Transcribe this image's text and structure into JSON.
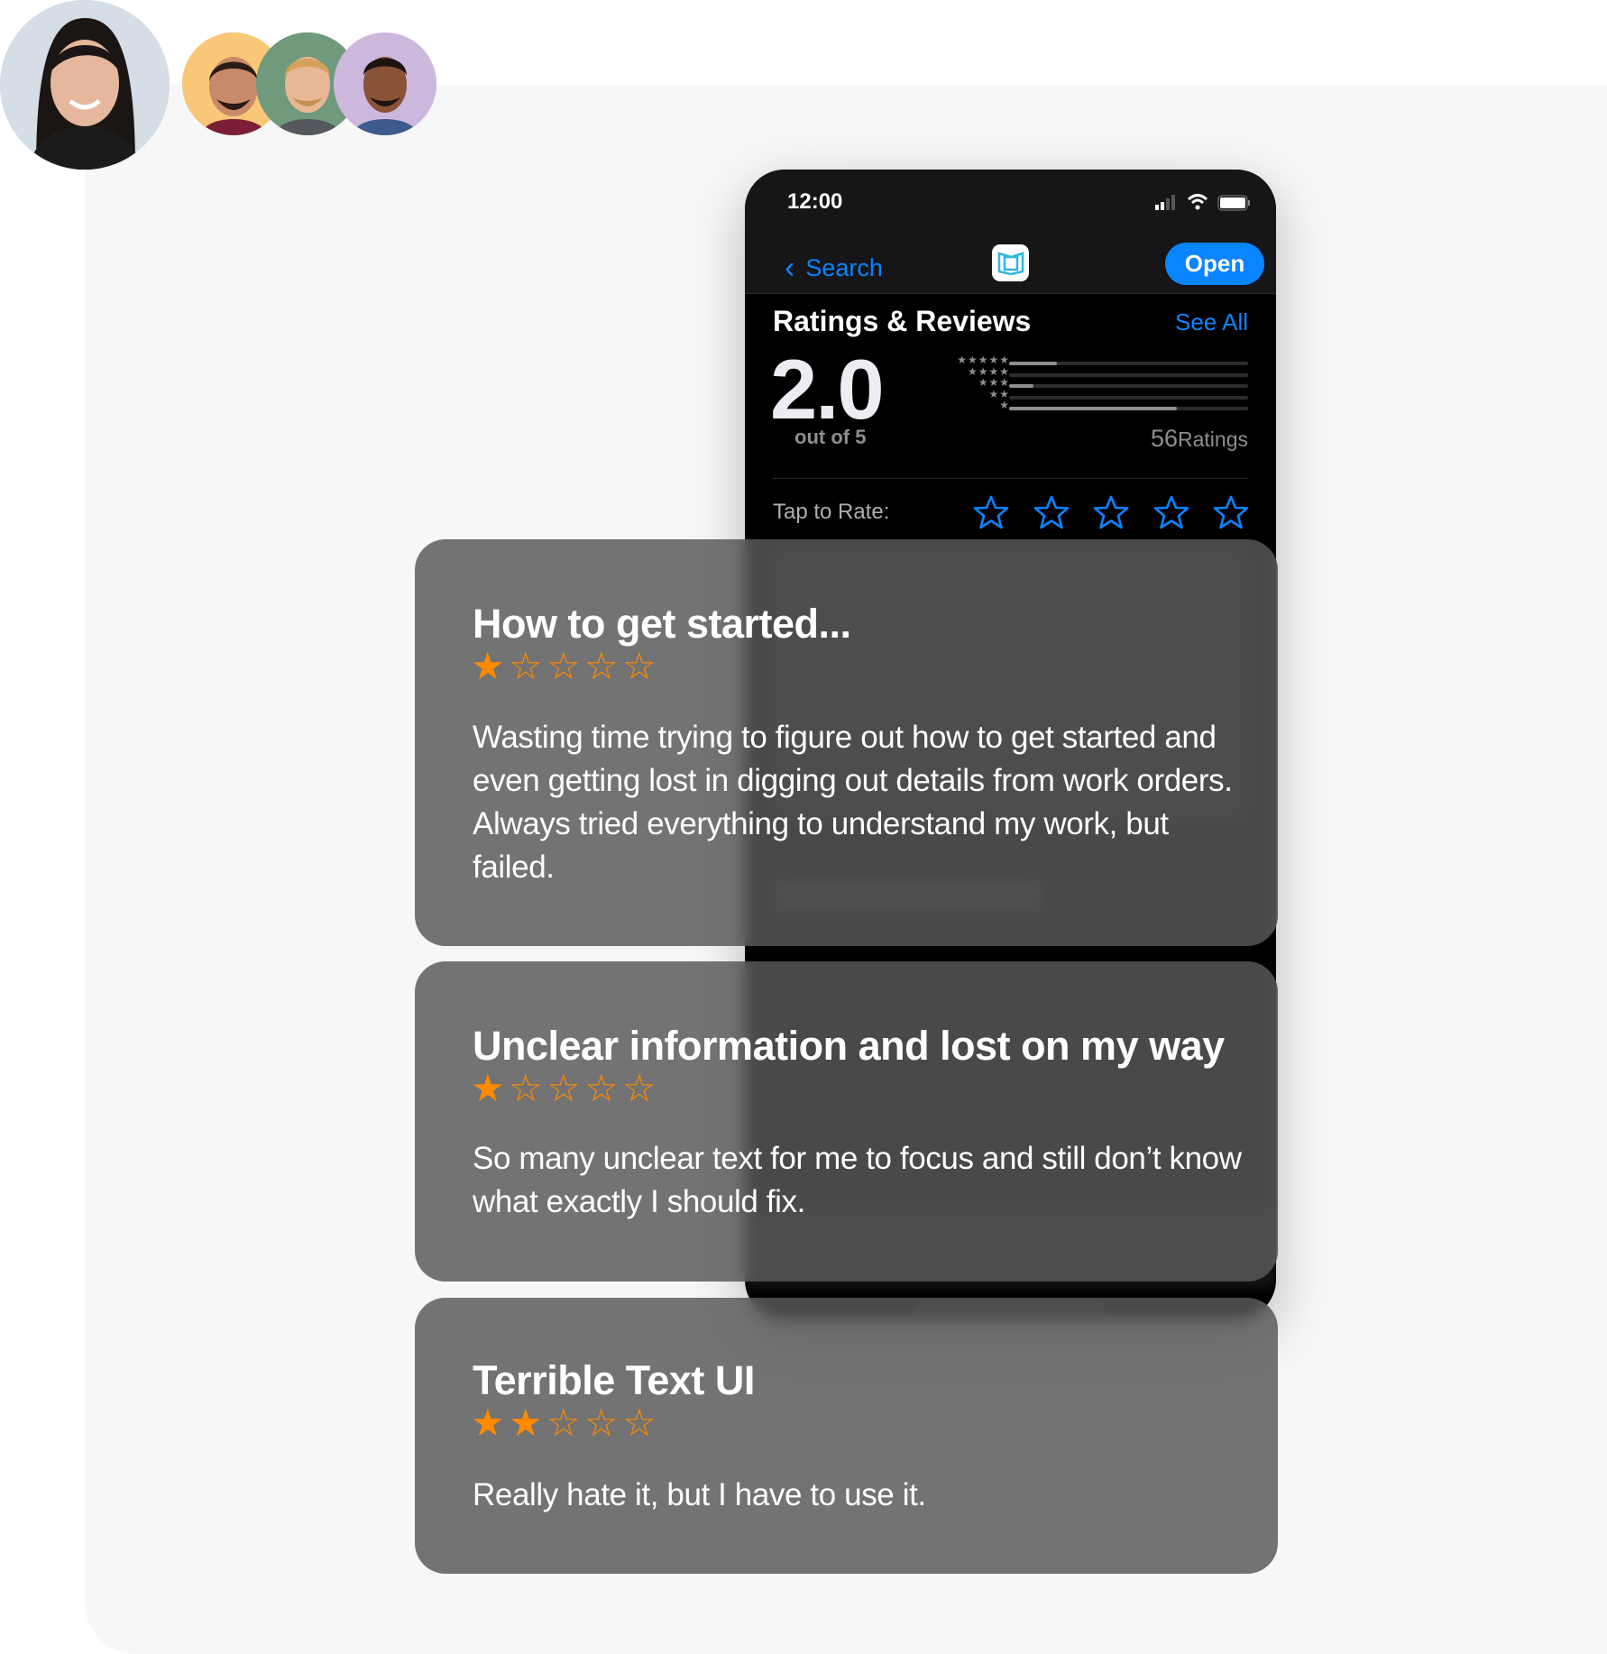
{
  "colors": {
    "accent": "#0a84ff",
    "star": "#ff8a00",
    "phone_bg": "#000000",
    "card_bg": "#6e6e6e"
  },
  "avatars": [
    {
      "name": "woman-photo"
    },
    {
      "name": "man-beard"
    },
    {
      "name": "man-blond"
    },
    {
      "name": "man-dark"
    }
  ],
  "phone": {
    "status": {
      "time": "12:00",
      "icons": [
        "signal-icon",
        "wifi-icon",
        "battery-icon"
      ]
    },
    "nav": {
      "back_label": "Search",
      "open_label": "Open",
      "app_icon": "book-icon"
    },
    "ratings": {
      "title": "Ratings & Reviews",
      "see_all": "See All",
      "score": "2.0",
      "out_of": "out of 5",
      "count": "56",
      "count_label": "Ratings",
      "distribution": [
        {
          "stars": "★★★★★",
          "fraction": 0.2
        },
        {
          "stars": "★★★★",
          "fraction": 0
        },
        {
          "stars": "★★★",
          "fraction": 0.1
        },
        {
          "stars": "★★",
          "fraction": 0
        },
        {
          "stars": "★",
          "fraction": 0.7
        }
      ],
      "tap_to_rate": "Tap to Rate:"
    }
  },
  "reviews": [
    {
      "title": "How to get started...",
      "rating": 1,
      "body": "Wasting time trying to figure out how to get started and even getting lost in digging out details from work orders. Always tried everything to understand my work, but failed."
    },
    {
      "title": "Unclear information and lost on my way",
      "rating": 1,
      "body": "So many unclear text for me to focus and still don’t know what exactly I should fix."
    },
    {
      "title": "Terrible Text UI",
      "rating": 2,
      "body": "Really hate it, but I have to use it."
    }
  ]
}
